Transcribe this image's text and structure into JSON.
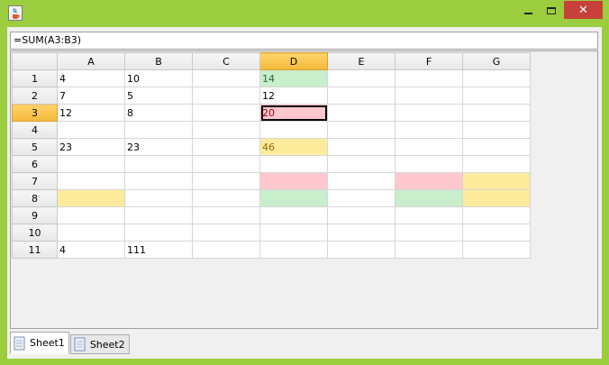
{
  "window": {
    "icon": "java-cup-icon",
    "controls": [
      "minimize-icon",
      "maximize-icon",
      "close-icon"
    ],
    "close_glyph": "✕"
  },
  "formula_bar": {
    "value": "=SUM(A3:B3)"
  },
  "grid": {
    "columns": [
      "A",
      "B",
      "C",
      "D",
      "E",
      "F",
      "G"
    ],
    "selected_column": "D",
    "selected_row": "3",
    "rows": [
      {
        "num": "1",
        "cells": [
          "4",
          "10",
          "",
          "14",
          "",
          "",
          ""
        ]
      },
      {
        "num": "2",
        "cells": [
          "7",
          "5",
          "",
          "12",
          "",
          "",
          ""
        ]
      },
      {
        "num": "3",
        "cells": [
          "12",
          "8",
          "",
          "20",
          "",
          "",
          ""
        ]
      },
      {
        "num": "4",
        "cells": [
          "",
          "",
          "",
          "",
          "",
          "",
          ""
        ]
      },
      {
        "num": "5",
        "cells": [
          "23",
          "23",
          "",
          "46",
          "",
          "",
          ""
        ]
      },
      {
        "num": "6",
        "cells": [
          "",
          "",
          "",
          "",
          "",
          "",
          ""
        ]
      },
      {
        "num": "7",
        "cells": [
          "",
          "",
          "",
          "",
          "",
          "",
          ""
        ]
      },
      {
        "num": "8",
        "cells": [
          "",
          "",
          "",
          "",
          "",
          "",
          ""
        ]
      },
      {
        "num": "9",
        "cells": [
          "",
          "",
          "",
          "",
          "",
          "",
          ""
        ]
      },
      {
        "num": "10",
        "cells": [
          "",
          "",
          "",
          "",
          "",
          "",
          ""
        ]
      },
      {
        "num": "11",
        "cells": [
          "4",
          "111",
          "",
          "",
          "",
          "",
          ""
        ]
      }
    ],
    "highlight_colors": {
      "green": "#c8eecb",
      "red": "#ffc7ce",
      "yellow": "#ffeb9c",
      "header_selected": "#f4b93a"
    }
  },
  "tabs": [
    {
      "label": "Sheet1",
      "active": true,
      "icon": "sheet-icon"
    },
    {
      "label": "Sheet2",
      "active": false,
      "icon": "sheet-icon"
    }
  ]
}
